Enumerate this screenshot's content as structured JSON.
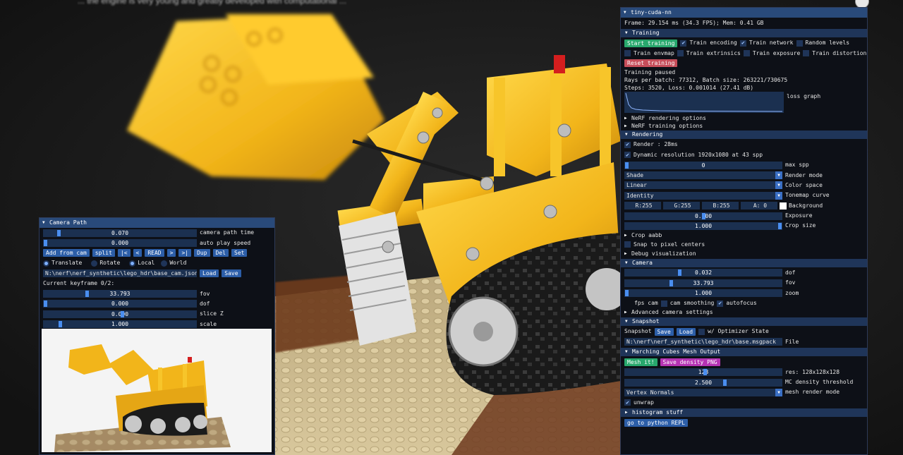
{
  "caption": "... the engine is very young and greatly developed with computational ...",
  "main_panel": {
    "title": "tiny-cuda-nn",
    "frame_info": "Frame: 29.154 ms (34.3 FPS); Mem: 0.41 GB",
    "training": {
      "header": "Training",
      "start_button": "Start training",
      "train_encoding": "Train encoding",
      "train_network": "Train network",
      "random_levels": "Random levels",
      "train_envmap": "Train envmap",
      "train_extrinsics": "Train extrinsics",
      "train_exposure": "Train exposure",
      "train_distortion": "Train distortion",
      "reset_button": "Reset training",
      "status": "Training paused",
      "rays_info": "Rays per batch: 77312, Batch size: 263221/730675",
      "steps_info": "Steps: 3520, Loss: 0.001014 (27.41 dB)",
      "loss_graph_label": "loss graph",
      "nerf_render_opts": "NeRF rendering options",
      "nerf_train_opts": "NeRF training options"
    },
    "rendering": {
      "header": "Rendering",
      "render_label": "Render : 28ms",
      "dyn_res": "Dynamic resolution 1920x1080 at 43 spp",
      "max_spp_value": "0",
      "max_spp_label": "max spp",
      "render_mode_value": "Shade",
      "render_mode_label": "Render mode",
      "color_space_value": "Linear",
      "color_space_label": "Color space",
      "tonemap_value": "Identity",
      "tonemap_label": "Tonemap curve",
      "bg_r": "R:255",
      "bg_g": "G:255",
      "bg_b": "B:255",
      "bg_a": "A:  0",
      "bg_label": "Background",
      "exposure_value": "0.000",
      "exposure_label": "Exposure",
      "crop_value": "1.000",
      "crop_label": "Crop size",
      "crop_aabb": "Crop aabb",
      "snap_pixel": "Snap to pixel centers",
      "debug_vis": "Debug visualization"
    },
    "camera": {
      "header": "Camera",
      "dof_value": "0.032",
      "dof_label": "dof",
      "fov_value": "33.793",
      "fov_label": "fov",
      "zoom_value": "1.000",
      "zoom_label": "zoom",
      "fps_cam": "fps cam",
      "cam_smoothing": "cam smoothing",
      "autofocus": "autofocus",
      "advanced": "Advanced camera settings"
    },
    "snapshot": {
      "header": "Snapshot",
      "label": "Snapshot",
      "save_button": "Save",
      "load_button": "Load",
      "optimizer_state": "w/ Optimizer State",
      "file_value": "N:\\nerf\\nerf_synthetic\\lego_hdr\\base.msgpack",
      "file_label": "File"
    },
    "marching": {
      "header": "Marching Cubes Mesh Output",
      "mesh_button": "Mesh it!",
      "save_density_button": "Save density PNG",
      "res_value": "128",
      "res_label": "res: 128x128x128",
      "mc_value": "2.500",
      "mc_label": "MC density threshold",
      "mesh_mode_value": "Vertex Normals",
      "mesh_mode_label": "mesh render mode",
      "unwrap": "unwrap"
    },
    "histogram": "histogram stuff",
    "python_button": "go to python REPL"
  },
  "camera_path_panel": {
    "title": "Camera Path",
    "path_time_value": "0.070",
    "path_time_label": "camera path time",
    "play_speed_value": "0.000",
    "play_speed_label": "auto play speed",
    "buttons": [
      "Add from cam",
      "split",
      "|<",
      "<",
      "READ",
      ">",
      ">|",
      "Dup",
      "Del",
      "Set"
    ],
    "translate": "Translate",
    "rotate": "Rotate",
    "local": "Local",
    "world": "World",
    "path_value": "N:\\nerf\\nerf_synthetic\\lego_hdr\\base_cam.json",
    "load_button": "Load",
    "save_button": "Save",
    "keyframe_info": "Current keyframe 0/2:",
    "fov_value": "33.793",
    "fov_label": "fov",
    "dof_value": "0.000",
    "dof_label": "dof",
    "slice_value": "0.000",
    "slice_label": "slice Z",
    "scale_value": "1.000",
    "scale_label": "scale"
  },
  "colors": {
    "panel_bg": "#0d1017",
    "header_bg": "#1f3559",
    "title_bg": "#294a7a",
    "slider_bg": "#1b3050",
    "grab": "#4a8ef0",
    "lego_yellow": "#f2b51a"
  }
}
